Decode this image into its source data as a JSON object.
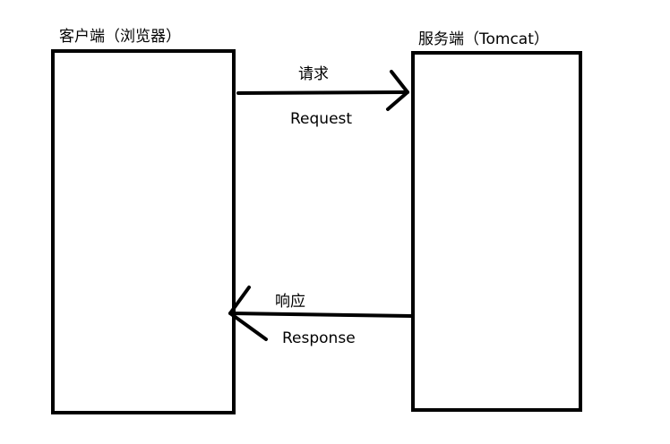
{
  "client": {
    "title": "客户端（浏览器）"
  },
  "server": {
    "title": "服务端（Tomcat）"
  },
  "request": {
    "label_cn": "请求",
    "label_en": "Request",
    "direction": "client-to-server"
  },
  "response": {
    "label_cn": "响应",
    "label_en": "Response",
    "direction": "server-to-client"
  },
  "colors": {
    "stroke": "#000000",
    "background": "#ffffff"
  }
}
